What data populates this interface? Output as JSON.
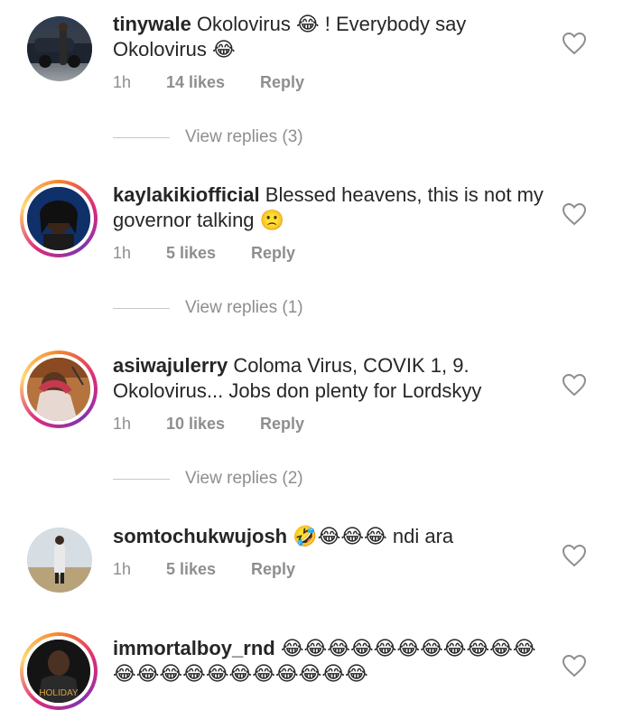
{
  "comments": [
    {
      "username": "tinywale",
      "text": "Okolovirus 😂 ! Everybody say Okolovirus 😂",
      "time": "1h",
      "likes": "14 likes",
      "reply": "Reply",
      "view_replies": "View replies (3)"
    },
    {
      "username": "kaylakikiofficial",
      "text": "Blessed heavens, this is not my governor talking 🙁",
      "time": "1h",
      "likes": "5 likes",
      "reply": "Reply",
      "view_replies": "View replies (1)"
    },
    {
      "username": "asiwajulerry",
      "text": "Coloma Virus, COVIK 1, 9. Okolovirus... Jobs don plenty for Lordskyy",
      "time": "1h",
      "likes": "10 likes",
      "reply": "Reply",
      "view_replies": "View replies (2)"
    },
    {
      "username": "somtochukwujosh",
      "text": "🤣😂😂😂 ndi ara",
      "time": "1h",
      "likes": "5 likes",
      "reply": "Reply"
    },
    {
      "username": "immortalboy_rnd",
      "text": "😂😂😂😂😂😂😂😂😂😂😂😂😂😂😂😂😂😂😂😂😂😂",
      "avatar_caption": "HOLIDAY"
    }
  ],
  "icons": {
    "heart": "heart-outline-icon"
  },
  "colors": {
    "username": "#262626",
    "meta": "#8e8e8e",
    "ring_start": "#f58529",
    "ring_mid": "#dd2a7b"
  }
}
